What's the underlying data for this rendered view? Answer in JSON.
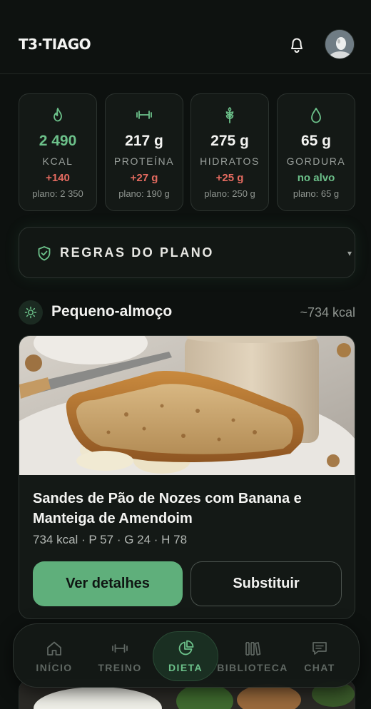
{
  "header": {
    "logo_text": "T3·TIAGO",
    "bell_icon": "bell-icon",
    "avatar_icon": "user-avatar"
  },
  "stats": [
    {
      "icon": "flame-icon",
      "value": "2 490",
      "unit": "KCAL",
      "delta": "+140",
      "plan": "plano: 2 350",
      "value_color": "#6cc18a",
      "delta_status": "over"
    },
    {
      "icon": "dumbbell-icon",
      "value": "217 g",
      "unit": "PROTEÍNA",
      "delta": "+27 g",
      "plan": "plano: 190 g",
      "delta_status": "over"
    },
    {
      "icon": "wheat-icon",
      "value": "275 g",
      "unit": "HIDRATOS",
      "delta": "+25 g",
      "plan": "plano: 250 g",
      "delta_status": "over"
    },
    {
      "icon": "droplet-icon",
      "value": "65 g",
      "unit": "GORDURA",
      "delta": "no alvo",
      "plan": "plano: 65 g",
      "delta_status": "ok"
    }
  ],
  "rules": {
    "label": "REGRAS DO PLANO",
    "icon": "shield-check-icon",
    "caret": "▾"
  },
  "meal": {
    "icon": "sun-icon",
    "title": "Pequeno-almoço",
    "kcal": "~734 kcal",
    "card": {
      "title": "Sandes de Pão de Nozes com Banana e Manteiga de Amendoim",
      "macros": "734 kcal · P 57 · G 24 · H 78",
      "primary_button": "Ver detalhes",
      "secondary_button": "Substituir"
    }
  },
  "nav": {
    "items": [
      {
        "label": "INÍCIO",
        "icon": "home-icon",
        "active": false
      },
      {
        "label": "TREINO",
        "icon": "dumbbell-icon",
        "active": false
      },
      {
        "label": "DIETA",
        "icon": "pie-chart-icon",
        "active": true
      },
      {
        "label": "BIBLIOTECA",
        "icon": "library-icon",
        "active": false
      },
      {
        "label": "CHAT",
        "icon": "chat-icon",
        "active": false
      }
    ]
  },
  "colors": {
    "accent": "#5faf7b",
    "over": "#e56b60",
    "background": "#0d110f",
    "card": "#141916"
  }
}
